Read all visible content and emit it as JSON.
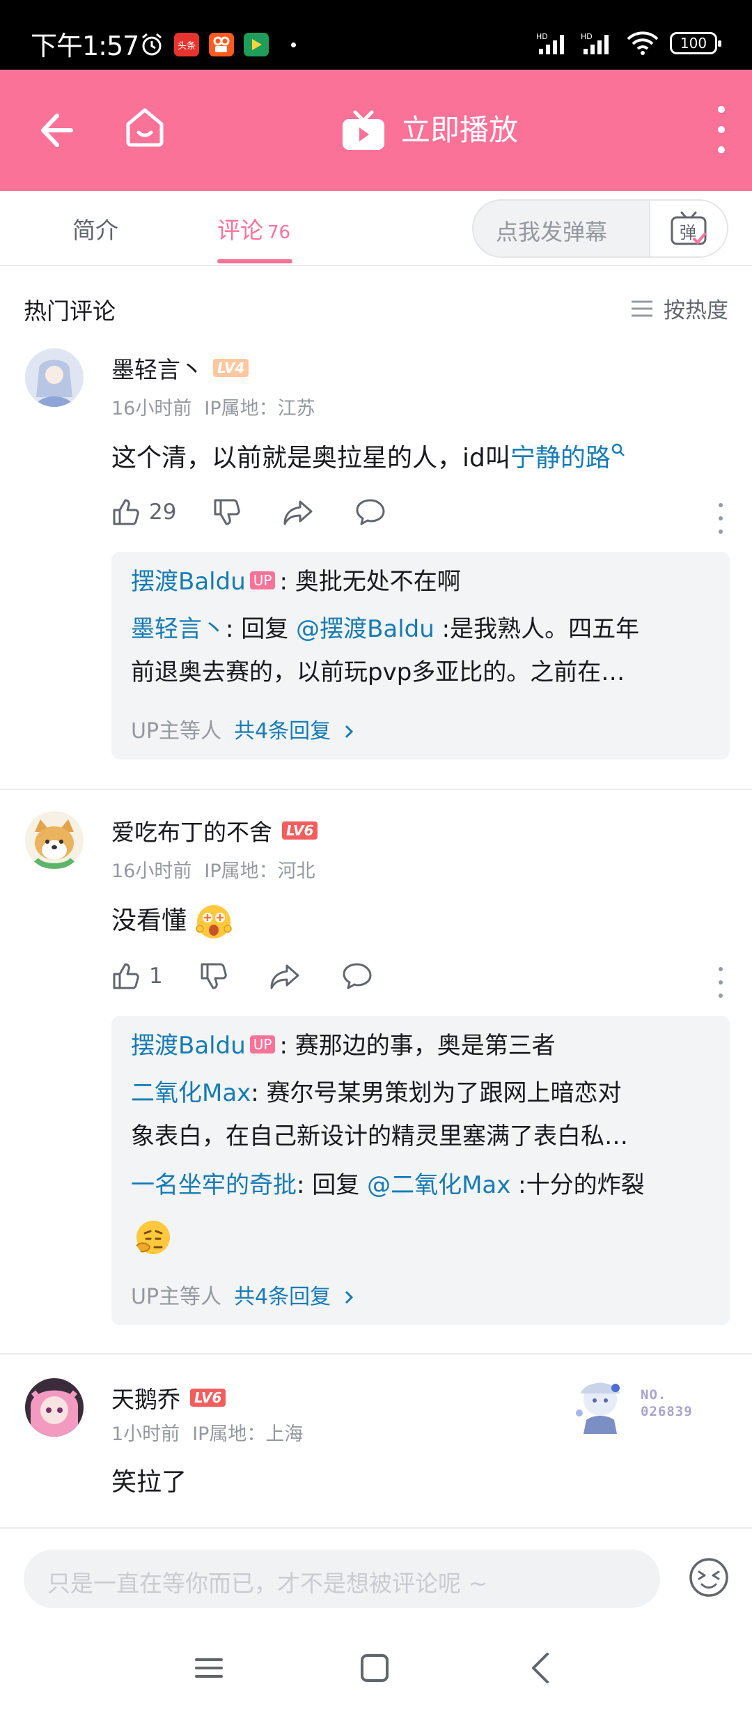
{
  "status_bar": {
    "time": "下午1:57",
    "apps": [
      "头条",
      "快手",
      "播放"
    ],
    "battery": "100"
  },
  "header": {
    "play_label": "立即播放"
  },
  "tabs": {
    "intro": "简介",
    "comments": "评论",
    "comments_count": "76",
    "danmaku_placeholder": "点我发弹幕",
    "danmaku_button": "弹"
  },
  "section": {
    "title": "热门评论",
    "sort_label": "按热度"
  },
  "comments": [
    {
      "user": "墨轻言丶",
      "level": "LV4",
      "time": "16小时前",
      "ip": "IP属地：江苏",
      "text": "这个清，以前就是奥拉星的人，id叫",
      "link": "宁静的路",
      "likes": "29",
      "replies": [
        {
          "who": "摆渡Baldu",
          "up": "UP",
          "text": ": 奥批无处不在啊"
        },
        {
          "who": "墨轻言丶",
          "text": ": 回复 ",
          "at": "@摆渡Baldu",
          "text2": " :是我熟人。四五年",
          "line2": "前退奥去赛的，以前玩pvp多亚比的。之前在…"
        }
      ],
      "reply_footer": "UP主等人",
      "reply_total": "共4条回复"
    },
    {
      "user": "爱吃布丁的不舍",
      "level": "LV6",
      "time": "16小时前",
      "ip": "IP属地：河北",
      "text": "没看懂",
      "likes": "1",
      "replies": [
        {
          "who": "摆渡Baldu",
          "up": "UP",
          "text": ": 赛那边的事，奥是第三者"
        },
        {
          "who": "二氧化Max",
          "text": ": 赛尔号某男策划为了跟网上暗恋对",
          "line2": "象表白，在自己新设计的精灵里塞满了表白私…"
        },
        {
          "who": "一名坐牢的奇批",
          "text": ": 回复 ",
          "at": "@二氧化Max",
          "text2": " :十分的炸裂"
        }
      ],
      "reply_footer": "UP主等人",
      "reply_total": "共4条回复"
    },
    {
      "user": "天鹅乔",
      "level": "LV6",
      "time": "1小时前",
      "ip": "IP属地：上海",
      "text": "笑拉了",
      "badge_no": "NO.",
      "badge_num": "026839"
    }
  ],
  "input": {
    "placeholder": "只是一直在等你而已，才不是想被评论呢 ~"
  },
  "colors": {
    "brand_pink": "#fb7299",
    "link_blue": "#167bb4"
  }
}
